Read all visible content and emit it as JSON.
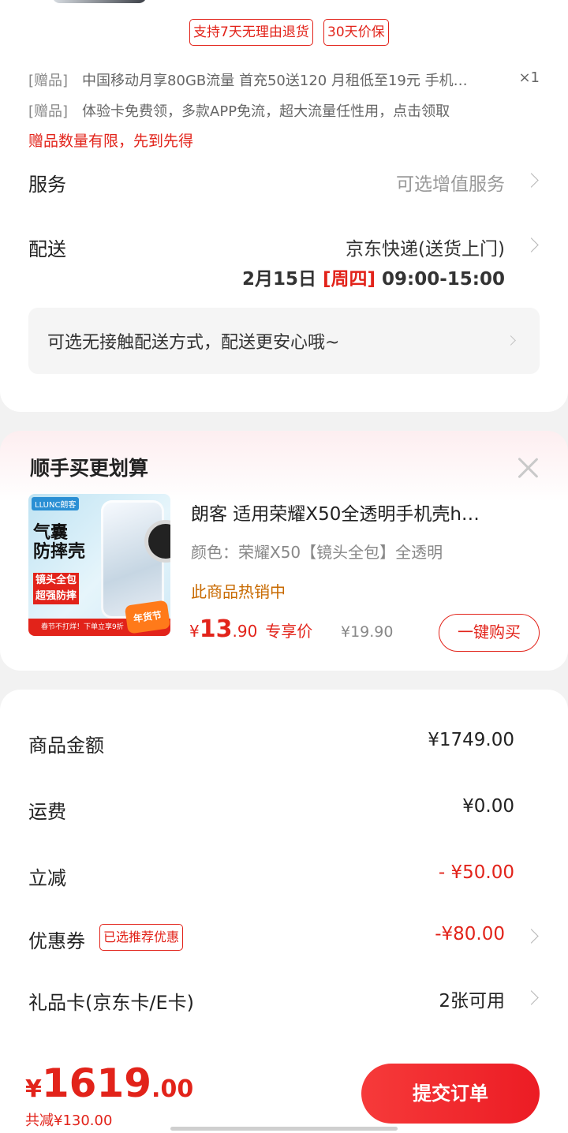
{
  "guarantees": [
    "支持7天无理由退货",
    "30天价保"
  ],
  "gifts": [
    {
      "tag": "[赠品]",
      "text": "中国移动月享80GB流量 首充50送120 月租低至19元 手机…",
      "qty": "×1"
    },
    {
      "tag": "[赠品]",
      "text": "体验卡免费领，多款APP免流，超大流量任性用，点击领取"
    }
  ],
  "gift_warning": "赠品数量有限，先到先得",
  "service": {
    "label": "服务",
    "value": "可选增值服务"
  },
  "delivery": {
    "label": "配送",
    "method": "京东快递(送货上门)",
    "date": "2月15日",
    "weekday": "[周四]",
    "time": "09:00-15:00",
    "tip": "可选无接触配送方式，配送更安心哦~"
  },
  "recommend": {
    "title": "顺手买更划算",
    "product": {
      "title": "朗客 适用荣耀X50全透明手机壳h…",
      "color": "颜色：荣耀X50【镜头全包】全透明",
      "hot": "此商品热销中",
      "price_currency": "¥",
      "price_int": "13",
      "price_dec": ".90",
      "price_label": "专享价",
      "orig_price": "¥19.90",
      "buy_label": "一键购买",
      "image": {
        "brand": "LLUNC朗客",
        "line1": "气囊",
        "line2": "防摔壳",
        "tag1": "镜头全包",
        "tag2": "超强防摔",
        "bar": "春节不打烊！下单立享9折",
        "badge": "年货节"
      }
    }
  },
  "fees": [
    {
      "label": "商品金额",
      "value": "¥1749.00"
    },
    {
      "label": "运费",
      "value": "¥0.00"
    },
    {
      "label": "立减",
      "value": "- ¥50.00"
    },
    {
      "label": "优惠券",
      "value": "-¥80.00",
      "tag": "已选推荐优惠"
    },
    {
      "label": "礼品卡(京东卡/E卡)",
      "value": "2张可用"
    }
  ],
  "bottom": {
    "currency": "¥",
    "total_int": "1619",
    "total_dec": ".00",
    "saved": "共减¥130.00",
    "submit": "提交订单"
  },
  "colors": {
    "accent": "#e2231a",
    "hot": "#c86a00"
  }
}
